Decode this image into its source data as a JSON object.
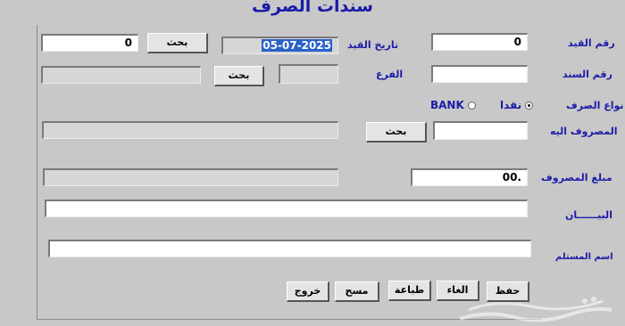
{
  "window": {
    "title": "سندات الصرف"
  },
  "labels": {
    "entry_no": "رقم القيد",
    "entry_date": "تاريخ القيد",
    "voucher_no": "رقم السند",
    "branch": "الفرع",
    "payment_type": "نواع الصرف",
    "paid_to": "المصروف اليه",
    "amount": "مبلغ المصروف",
    "description": "البيــــــان",
    "receiver": "اسم المستلم"
  },
  "fields": {
    "entry_no": "0",
    "entry_date": "05-07-2025",
    "search_value": "0",
    "voucher_no": "",
    "branch_code": "",
    "branch_name": "",
    "paid_to_code": "",
    "paid_to_name": "",
    "amount": "00.",
    "amount_words": "",
    "description": "",
    "receiver": ""
  },
  "payment_options": {
    "cash": {
      "label": "نقدا",
      "selected": true
    },
    "bank": {
      "label": "BANK",
      "selected": false
    }
  },
  "buttons": {
    "search": "بحث",
    "save": "حفظ",
    "cancel": "الغاء",
    "print": "طباعة",
    "clear": "مسح",
    "exit": "خروج"
  }
}
